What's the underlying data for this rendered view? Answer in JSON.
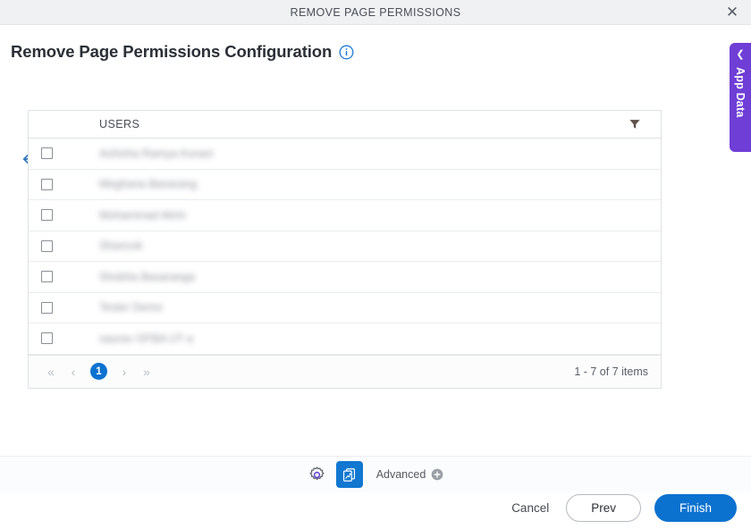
{
  "window": {
    "title": "REMOVE PAGE PERMISSIONS",
    "close_icon": "close-icon"
  },
  "side_panel": {
    "label": "App Data",
    "chevron_icon": "chevron-left-icon",
    "accent_color": "#6f3ed6"
  },
  "header": {
    "title": "Remove Page Permissions Configuration",
    "info_icon": "info-circle-icon",
    "back_icon": "arrow-left-icon"
  },
  "grid": {
    "columns": [
      "",
      "USERS"
    ],
    "filter_icon": "filter-funnel-icon",
    "rows": [
      {
        "checked": false,
        "user": "Ashisha Ramya Korani"
      },
      {
        "checked": false,
        "user": "Meghana Basarang"
      },
      {
        "checked": false,
        "user": "Mohammad Akrin"
      },
      {
        "checked": false,
        "user": "Shancok"
      },
      {
        "checked": false,
        "user": "Shobha Basaranga"
      },
      {
        "checked": false,
        "user": "Tester Demo"
      },
      {
        "checked": false,
        "user": "saurav OFBA UT a"
      }
    ],
    "pager": {
      "first_icon": "chevron-double-left-icon",
      "prev_icon": "chevron-left-icon",
      "current_page": "1",
      "next_icon": "chevron-right-icon",
      "last_icon": "chevron-double-right-icon",
      "summary": "1 - 7 of 7 items",
      "active_color": "#0c72d0"
    }
  },
  "toolbar": {
    "settings_icon": "gear-icon",
    "pages_icon": "copy-pages-icon",
    "advanced_label": "Advanced",
    "advanced_add_icon": "plus-circle-icon",
    "active_button_color": "#1177d1"
  },
  "actions": {
    "cancel_label": "Cancel",
    "prev_label": "Prev",
    "finish_label": "Finish",
    "finish_color": "#0c72d0"
  }
}
